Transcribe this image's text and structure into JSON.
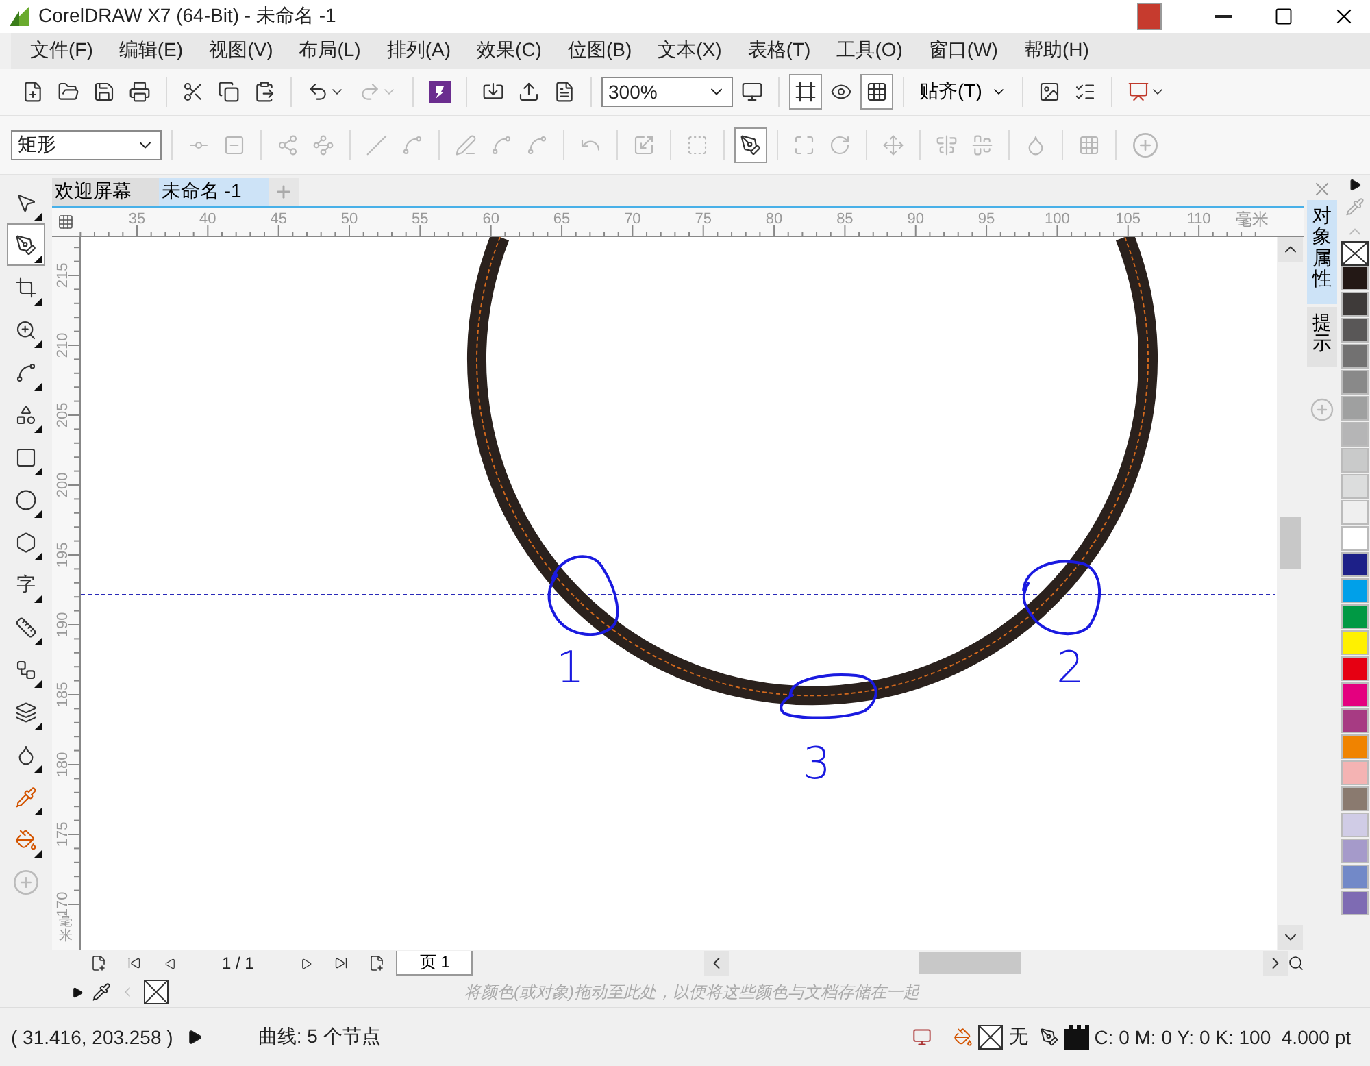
{
  "window": {
    "title": "CorelDRAW X7 (64-Bit) - 未命名 -1"
  },
  "menu": [
    "文件(F)",
    "编辑(E)",
    "视图(V)",
    "布局(L)",
    "排列(A)",
    "效果(C)",
    "位图(B)",
    "文本(X)",
    "表格(T)",
    "工具(O)",
    "窗口(W)",
    "帮助(H)"
  ],
  "toolbar": {
    "zoom": "300%",
    "snap": "贴齐(T)"
  },
  "property_bar": {
    "shape_type": "矩形"
  },
  "toolbox": {
    "text_tool": "字"
  },
  "doc_tabs": [
    {
      "label": "欢迎屏幕",
      "selected": false
    },
    {
      "label": "未命名 -1",
      "selected": true
    }
  ],
  "ruler": {
    "horizontal": [
      "35",
      "40",
      "45",
      "50",
      "55",
      "60",
      "65",
      "70",
      "75",
      "80",
      "85",
      "90",
      "95",
      "100",
      "105",
      "110"
    ],
    "unit": "毫米",
    "vertical": [
      "215",
      "210",
      "205",
      "200",
      "195",
      "190",
      "185",
      "180",
      "175",
      "170"
    ],
    "vertical_unit": "毫米"
  },
  "annotations": [
    "1",
    "2",
    "3"
  ],
  "page_nav": {
    "pages": "1 / 1",
    "tab": "页 1"
  },
  "palette_well": {
    "hint": "将颜色(或对象)拖动至此处，以便将这些颜色与文档存储在一起"
  },
  "docker_tabs": [
    {
      "label": "对象属性",
      "selected": true
    },
    {
      "label": "提示",
      "selected": false
    }
  ],
  "palette": [
    {
      "color": "#231815"
    },
    {
      "color": "#3e3a39"
    },
    {
      "color": "#595757"
    },
    {
      "color": "#727171"
    },
    {
      "color": "#898989"
    },
    {
      "color": "#9fa0a0"
    },
    {
      "color": "#b5b5b6"
    },
    {
      "color": "#c9caca"
    },
    {
      "color": "#dcdddd"
    },
    {
      "color": "#efefef"
    },
    {
      "color": "#ffffff"
    },
    {
      "color": "#1d2088"
    },
    {
      "color": "#00a0e9"
    },
    {
      "color": "#009944"
    },
    {
      "color": "#fff100"
    },
    {
      "color": "#e60012"
    },
    {
      "color": "#e4007f"
    },
    {
      "color": "#a73b83"
    },
    {
      "color": "#f08300"
    },
    {
      "color": "#f4b3b3"
    },
    {
      "color": "#8a7a6f"
    },
    {
      "color": "#d0cce6"
    },
    {
      "color": "#a59aca"
    },
    {
      "color": "#7289c8"
    },
    {
      "color": "#7e6bb3"
    }
  ],
  "status": {
    "coordinates": "( 31.416, 203.258 )",
    "selection": "曲线: 5 个节点",
    "fill": "无",
    "outline": "C: 0 M: 0 Y: 0 K: 100  4.000 pt"
  }
}
